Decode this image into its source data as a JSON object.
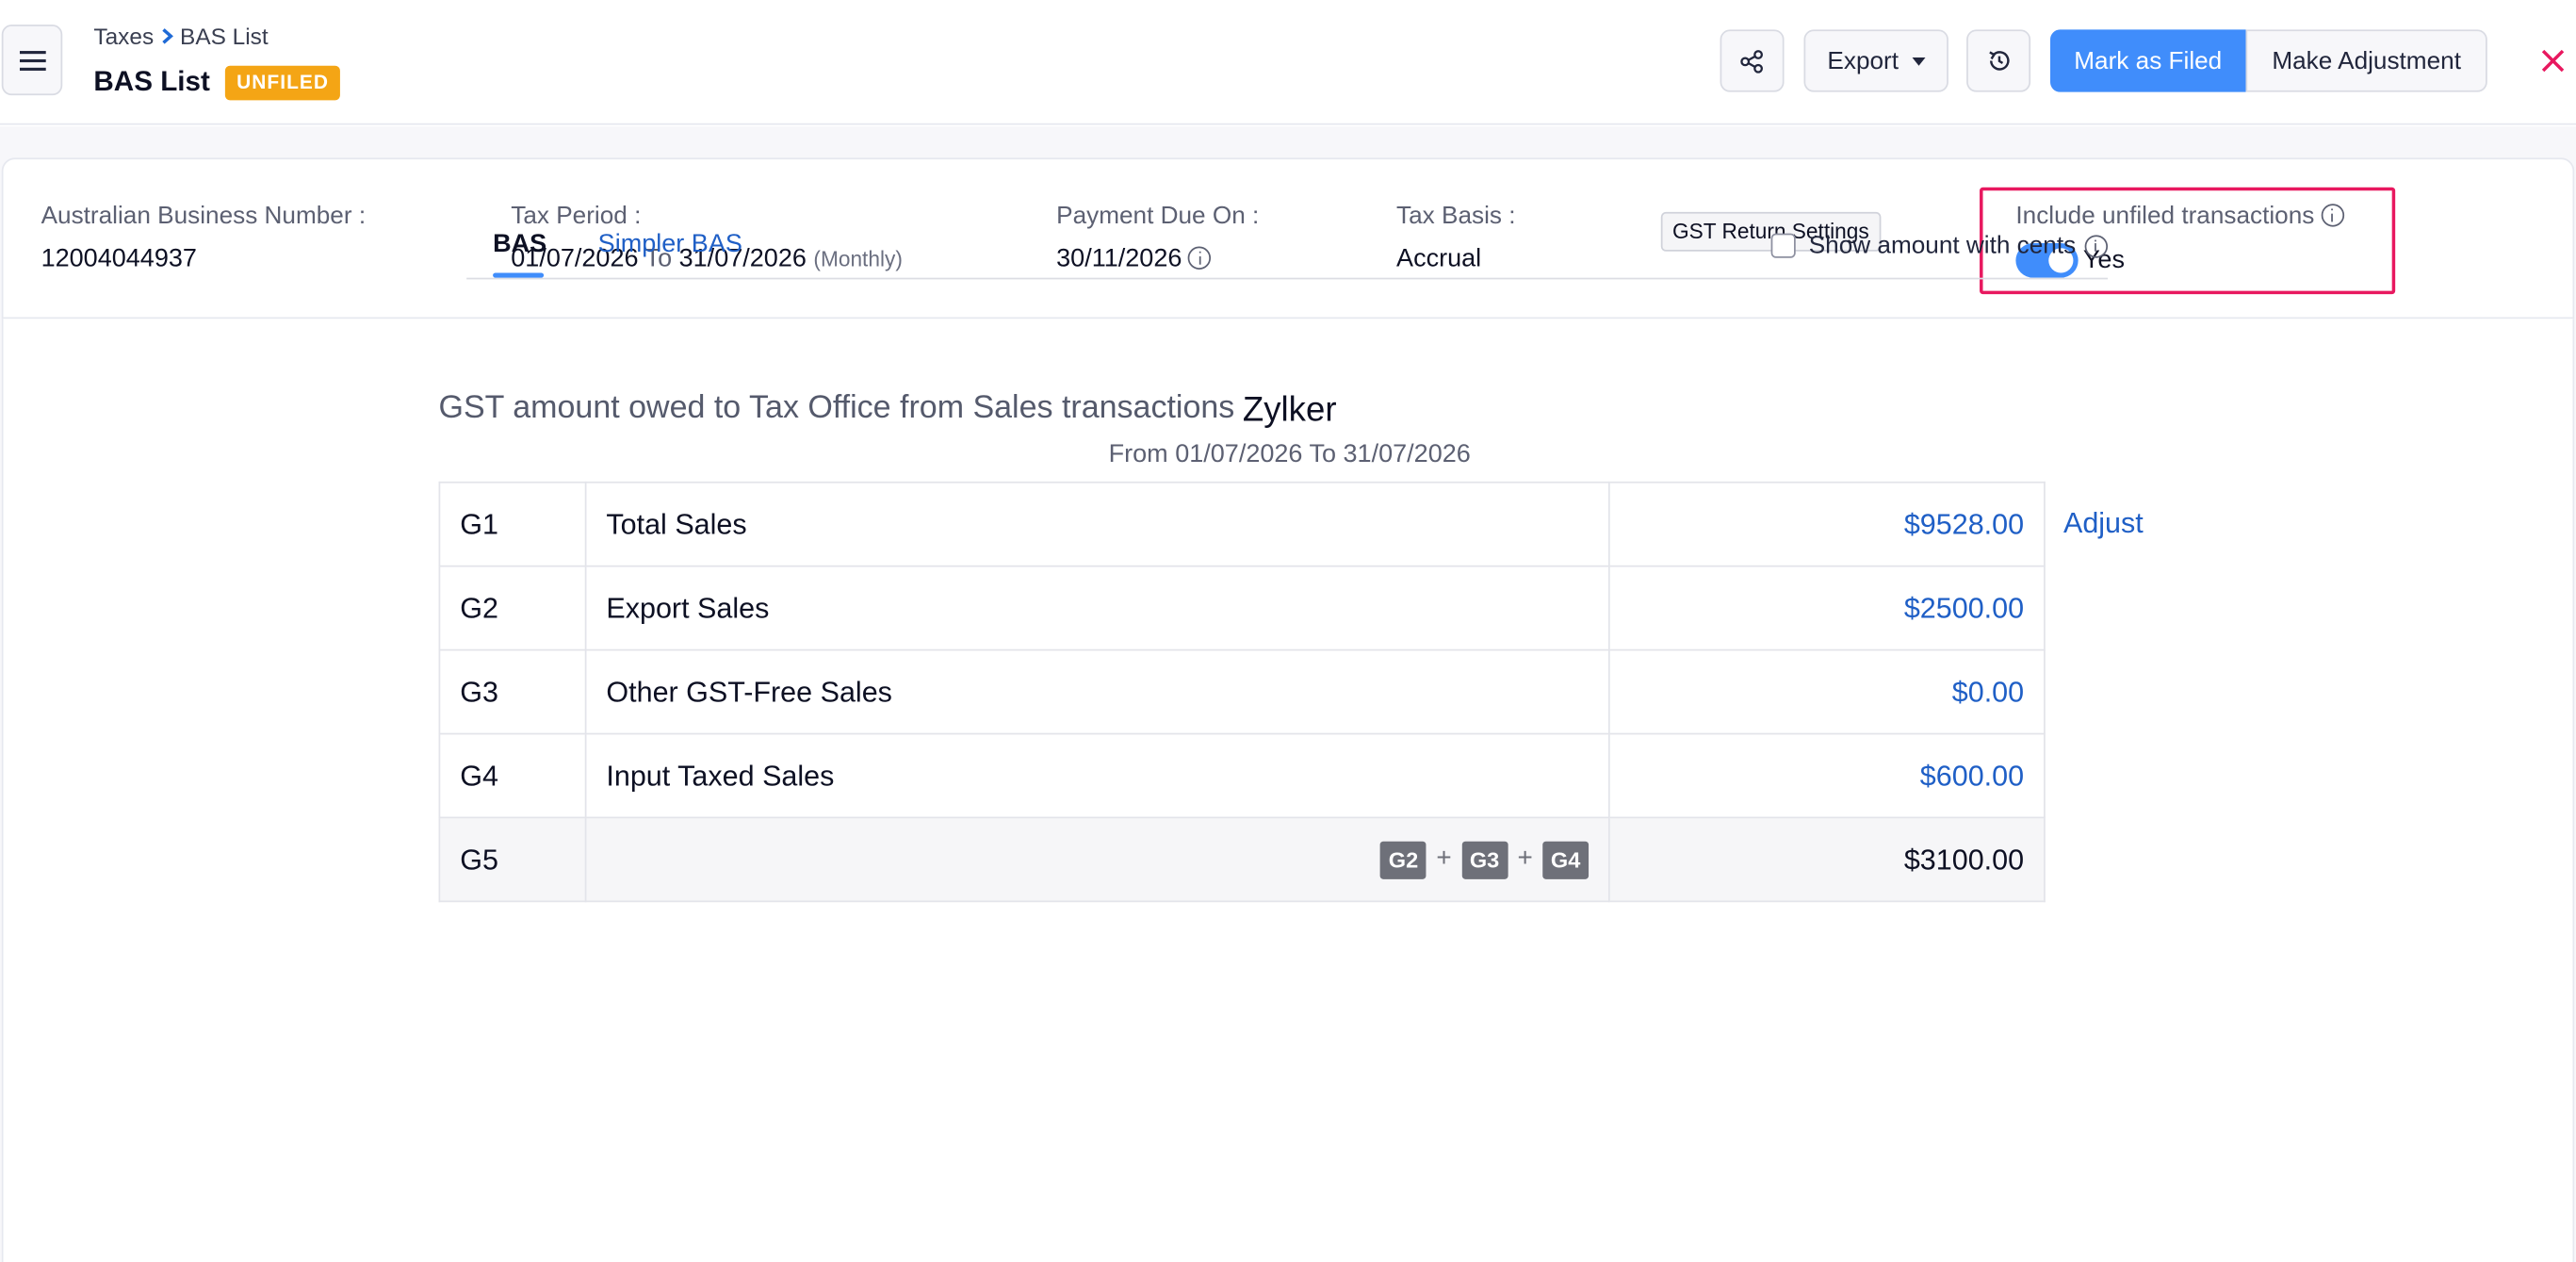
{
  "header": {
    "breadcrumb": {
      "parent": "Taxes",
      "current": "BAS List"
    },
    "title": "BAS List",
    "status_badge": "UNFILED",
    "buttons": {
      "export": "Export",
      "mark_as_filed": "Mark as Filed",
      "make_adjustment": "Make Adjustment"
    },
    "icons": {
      "menu": "hamburger-icon",
      "share": "share-icon",
      "history": "history-icon",
      "close": "close-icon"
    }
  },
  "info": {
    "abn_label": "Australian Business Number :",
    "abn_value": "12004044937",
    "tax_period_label": "Tax Period :",
    "tax_period_start": "01/07/2026",
    "tax_period_to": "To",
    "tax_period_end": "31/07/2026",
    "tax_period_frequency": "(Monthly)",
    "payment_due_label": "Payment Due On :",
    "payment_due_value": "30/11/2026",
    "tax_basis_label": "Tax Basis :",
    "tax_basis_value": "Accrual",
    "gst_settings_button": "GST Return Settings",
    "include_unfiled_label": "Include unfiled transactions",
    "include_unfiled_state": "Yes"
  },
  "report": {
    "org_name": "Zylker",
    "date_range": "From 01/07/2026 To 31/07/2026",
    "tabs": {
      "bas": "BAS",
      "simpler_bas": "Simpler BAS"
    },
    "show_cents_label": "Show amount with cents",
    "section_title": "GST amount owed to Tax Office from Sales transactions",
    "adjust_link": "Adjust",
    "rows": [
      {
        "code": "G1",
        "label": "Total Sales",
        "amount": "$9528.00"
      },
      {
        "code": "G2",
        "label": "Export Sales",
        "amount": "$2500.00"
      },
      {
        "code": "G3",
        "label": "Other GST-Free Sales",
        "amount": "$0.00"
      },
      {
        "code": "G4",
        "label": "Input Taxed Sales",
        "amount": "$600.00"
      }
    ],
    "total_row": {
      "code": "G5",
      "formula": [
        "G2",
        "+",
        "G3",
        "+",
        "G4"
      ],
      "amount": "$3100.00"
    }
  },
  "colors": {
    "primary": "#408dfb",
    "link": "#1f5fc6",
    "badge": "#f4a515",
    "highlight": "#e8185f"
  }
}
